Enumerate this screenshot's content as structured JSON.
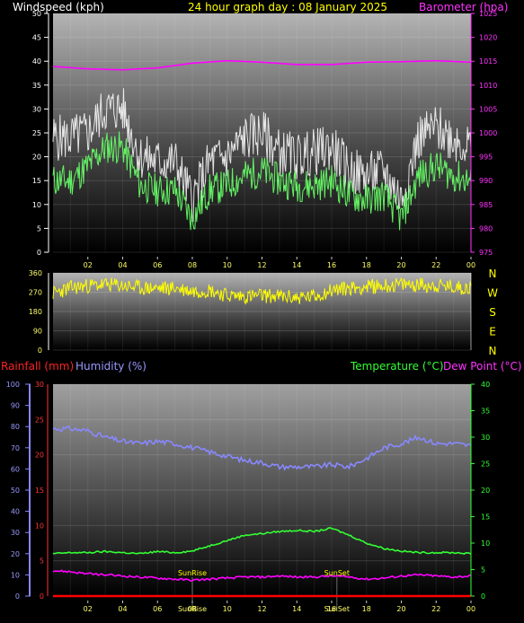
{
  "chart_data": [
    {
      "type": "line",
      "panel": "wind-pressure",
      "title": "24 hour graph day : 08 January 2025",
      "ylabel_left": "Windspeed (kph)",
      "ylabel_right": "Barometer (hpa)",
      "x_ticks": [
        "02",
        "04",
        "06",
        "08",
        "10",
        "12",
        "14",
        "16",
        "18",
        "20",
        "22",
        "00"
      ],
      "y_left_ticks": [
        "0",
        "5",
        "10",
        "15",
        "20",
        "25",
        "30",
        "35",
        "40",
        "45",
        "50"
      ],
      "y_right_ticks": [
        "975",
        "980",
        "985",
        "990",
        "995",
        "1000",
        "1005",
        "1010",
        "1015",
        "1020",
        "1025"
      ],
      "ylim_left": [
        0,
        50
      ],
      "ylim_right": [
        975,
        1025
      ],
      "series": [
        {
          "color": "#ffffff",
          "x": [
            1,
            2,
            3,
            4,
            5,
            6,
            7,
            8,
            9,
            10,
            11,
            12,
            13,
            14,
            15,
            16,
            17,
            18,
            19,
            20,
            21,
            22,
            23,
            24
          ],
          "values": [
            24,
            25,
            30,
            30,
            20,
            19,
            19,
            11,
            19,
            20,
            24,
            25,
            21,
            20,
            21,
            22,
            17,
            16,
            17,
            11,
            24,
            26,
            24,
            22
          ]
        },
        {
          "color": "#66ff66",
          "x": [
            1,
            2,
            3,
            4,
            5,
            6,
            7,
            8,
            9,
            10,
            11,
            12,
            13,
            14,
            15,
            16,
            17,
            18,
            19,
            20,
            21,
            22,
            23,
            24
          ],
          "values": [
            15,
            18,
            22,
            22,
            14,
            13,
            13,
            7,
            13,
            14,
            16,
            17,
            15,
            14,
            14,
            15,
            12,
            11,
            12,
            7,
            16,
            18,
            16,
            15
          ]
        },
        {
          "color": "#ff00ff",
          "x": [
            0,
            2,
            4,
            6,
            8,
            10,
            12,
            14,
            16,
            18,
            20,
            22,
            24
          ],
          "values": [
            1013.9,
            1013.4,
            1013.2,
            1013.6,
            1014.6,
            1015.1,
            1014.8,
            1014.3,
            1014.3,
            1014.8,
            1014.9,
            1015.1,
            1014.8
          ]
        }
      ]
    },
    {
      "type": "scatter",
      "panel": "wind-direction",
      "x_ticks": [
        "02",
        "04",
        "06",
        "08",
        "10",
        "12",
        "14",
        "16",
        "18",
        "20",
        "22",
        "00"
      ],
      "y_ticks": [
        "0",
        "90",
        "180",
        "270",
        "360"
      ],
      "ylim": [
        0,
        360
      ],
      "compass_labels": [
        "N",
        "W",
        "S",
        "E",
        "N"
      ],
      "series": [
        {
          "color": "#ffff00",
          "x": [
            0,
            1,
            2,
            3,
            4,
            5,
            6,
            7,
            8,
            9,
            10,
            11,
            12,
            13,
            14,
            15,
            16,
            17,
            18,
            19,
            20,
            21,
            22,
            23,
            24
          ],
          "values": [
            265,
            290,
            300,
            305,
            300,
            290,
            288,
            290,
            275,
            280,
            255,
            250,
            255,
            250,
            245,
            250,
            280,
            290,
            295,
            300,
            305,
            305,
            300,
            295,
            290
          ]
        }
      ]
    },
    {
      "type": "line",
      "panel": "rain-humidity-temp",
      "labels": {
        "rainfall": "Rainfall (mm)",
        "humidity": "Humidity (%)",
        "temperature": "Temperature (°C)",
        "dewpoint": "Dew Point (°C)"
      },
      "sunrise_label": "SunRise",
      "sunset_label": "SunSet",
      "bottom_sunrise": "SunRise",
      "bottom_sunset": "SunSet",
      "x_ticks": [
        "02",
        "04",
        "06",
        "08",
        "10",
        "12",
        "14",
        "16",
        "18",
        "20",
        "22",
        "00"
      ],
      "humidity_ticks": [
        "0",
        "10",
        "20",
        "30",
        "40",
        "50",
        "60",
        "70",
        "80",
        "90",
        "100"
      ],
      "rain_ticks": [
        "0",
        "5",
        "10",
        "15",
        "20",
        "25",
        "30"
      ],
      "temp_ticks": [
        "0",
        "5",
        "10",
        "15",
        "20",
        "25",
        "30",
        "35",
        "40"
      ],
      "ylim_humidity": [
        0,
        100
      ],
      "ylim_rain": [
        0,
        30
      ],
      "ylim_temp": [
        0,
        40
      ],
      "series": [
        {
          "color": "#8888ff",
          "axis": "humidity",
          "x": [
            0,
            1,
            2,
            3,
            4,
            5,
            6,
            7,
            8,
            9,
            10,
            11,
            12,
            13,
            14,
            15,
            16,
            17,
            18,
            19,
            20,
            21,
            22,
            23,
            24
          ],
          "values": [
            79,
            79,
            78,
            75,
            73,
            72,
            73,
            72,
            70,
            68,
            66,
            64,
            63,
            61,
            61,
            61,
            62,
            61,
            65,
            70,
            72,
            75,
            72,
            72,
            71
          ]
        },
        {
          "color": "#33ff33",
          "axis": "temp",
          "x": [
            0,
            1,
            2,
            3,
            4,
            5,
            6,
            7,
            8,
            9,
            10,
            11,
            12,
            13,
            14,
            15,
            16,
            17,
            18,
            19,
            20,
            21,
            22,
            23,
            24
          ],
          "values": [
            8.0,
            8.2,
            8.2,
            8.4,
            8.2,
            8.0,
            8.4,
            8.2,
            8.5,
            9.5,
            10.5,
            11.5,
            11.8,
            12.2,
            12.4,
            12.2,
            12.8,
            11.5,
            10.0,
            9.0,
            8.5,
            8.2,
            8.2,
            8.2,
            8.0
          ]
        },
        {
          "color": "#ff00ff",
          "axis": "temp",
          "x": [
            0,
            1,
            2,
            3,
            4,
            5,
            6,
            7,
            8,
            9,
            10,
            11,
            12,
            13,
            14,
            15,
            16,
            17,
            18,
            19,
            20,
            21,
            22,
            23,
            24
          ],
          "values": [
            4.8,
            4.6,
            4.2,
            4.0,
            3.8,
            3.6,
            3.4,
            3.2,
            3.0,
            3.2,
            3.4,
            3.6,
            3.6,
            3.8,
            3.6,
            3.6,
            3.8,
            3.6,
            3.2,
            3.4,
            3.8,
            4.0,
            3.8,
            3.6,
            3.8
          ]
        },
        {
          "color": "#ff0000",
          "axis": "rain",
          "x": [
            0,
            24
          ],
          "values": [
            0,
            0
          ]
        }
      ]
    }
  ]
}
